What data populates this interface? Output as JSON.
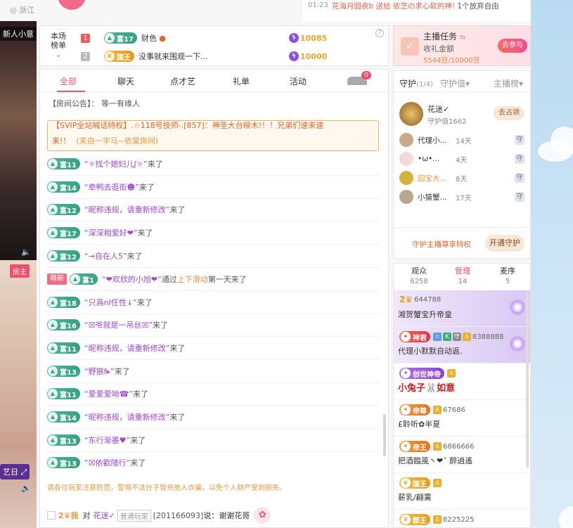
{
  "topbar": {
    "location": "浙江",
    "time": "01:23",
    "marquee_pre": "花海月圆夜b 送给 ",
    "marquee_mid": "依芝の求心软的神!",
    "marquee_post": "  1个放弃自由"
  },
  "leftstrip": {
    "tag_top": "新人小意",
    "tag_host": "房主",
    "tag_bottom": "艺日"
  },
  "rank": {
    "title": "本场榜单",
    "rows": [
      {
        "num": "1",
        "level": "富17",
        "name": "财色",
        "score": "10085",
        "num_color": "#f05a5a"
      },
      {
        "num": "2",
        "level": "国王",
        "name": "没事就来围观一下...",
        "score": "10000",
        "num_color": "#bbbbbb"
      }
    ]
  },
  "task": {
    "title": "主播任务",
    "subtitle": "收礼金额",
    "progress": "5544豆/10000豆",
    "button": "去参与"
  },
  "chat": {
    "tabs": [
      "全部",
      "聊天",
      "点才艺",
      "礼单",
      "活动"
    ],
    "car_count": "0",
    "notice": "【房间公告】：  等一有缘人",
    "svip_line1": "【SVIP全站喊话特权】.☆118号技师-.[857]：神圣大台映木!！！兄弟们速来速",
    "svip_line2": "来!！",
    "svip_from": "(来自一字马~依棠房间)",
    "messages": [
      {
        "level": "富11",
        "name": "“☼找个媳妇儿ʃ☼”",
        "text": "来了"
      },
      {
        "level": "富14",
        "name": "“牵鸭去逛街☻”",
        "text": "来了"
      },
      {
        "level": "富12",
        "name": "“昵称违规，请重新修改”",
        "text": "来了"
      },
      {
        "level": "富17",
        "name": "“深深相爱好❤”",
        "text": "来了"
      },
      {
        "level": "富12",
        "name": "“→自在人5”",
        "text": "来了"
      },
      {
        "new": "萌新",
        "level": "富1",
        "name": "“❤欢欣的小旭❤”",
        "text": "通过",
        "hl": "上下滑动",
        "text2": "第一天来了"
      },
      {
        "level": "富18",
        "name": "“只爲nI任性↓”",
        "text": "来了"
      },
      {
        "level": "富16",
        "name": "“☒爷就是一吊丝☒”",
        "text": "来了"
      },
      {
        "level": "富11",
        "name": "“昵称违规，请重新修改”",
        "text": "来了"
      },
      {
        "level": "富13",
        "name": "“野狼f▸”",
        "text": "来了"
      },
      {
        "level": "富11",
        "name": "“爱爱爱呦☎”",
        "text": "来了"
      },
      {
        "level": "富14",
        "name": "“昵称违规，请重新修改”",
        "text": "来了"
      },
      {
        "level": "富13",
        "name": "“东行渐墨♥”",
        "text": "来了"
      },
      {
        "level": "富13",
        "name": "“☒依歡隨行”",
        "text": "来了"
      }
    ],
    "warning": "请各位玩家注意防范，警惕不法分子冒充他人诈骗，以免个人财产受到损失。",
    "bottom_me": "2♛我",
    "bottom_to": "对",
    "bottom_target": "花迷✓",
    "bottom_tag": "普通玩家",
    "bottom_id": "[201166093]",
    "bottom_say": "说：",
    "bottom_text": "谢谢花哥"
  },
  "guard": {
    "tab1": "守护",
    "tab1_count": "(1/4)",
    "tab2": "守护值▾",
    "tab3": "主播榜▾",
    "top_name": "花迷✓",
    "top_value": "守护值1662",
    "claim": "去占领",
    "list": [
      {
        "name": "代理小...",
        "days": "14天",
        "color": "#c9a98a"
      },
      {
        "name": "•ω•...",
        "days": "4天",
        "color": "#f3d9d9"
      },
      {
        "name": "园宝大...",
        "days": "8天",
        "color": "#d4b23c"
      },
      {
        "name": "小猿蟹...",
        "days": "17天",
        "color": "#b8a890"
      }
    ],
    "footer_text": "守护主播尊享特权",
    "open_button": "开通守护"
  },
  "audience": {
    "tabs": [
      {
        "label": "观众",
        "count": "6258"
      },
      {
        "label": "管理",
        "count": "14"
      },
      {
        "label": "麦序",
        "count": "5"
      }
    ],
    "users": [
      {
        "id": "644788",
        "name": "湘贺蟹宝升帝皇",
        "badge": "",
        "vip": true
      },
      {
        "id": "8388888",
        "name": "代理小默默自动返.",
        "badge": "神君",
        "vip": true
      },
      {
        "id": "",
        "name": "小兔子🐰如意",
        "badge": "创世神帝",
        "vip": false,
        "big": true
      },
      {
        "id": "67686",
        "name": "£聆听✿半夏",
        "badge": "帝尊",
        "vip": false
      },
      {
        "id": "6866666",
        "name": "把酒臨風丶❤ˇ 醉逍遙",
        "badge": "帝王",
        "vip": false
      },
      {
        "id": "",
        "name": "薪乳/翩霙",
        "badge": "国王",
        "vip": false
      },
      {
        "id": "8225225",
        "name": "",
        "badge": "郡王",
        "vip": false
      }
    ]
  }
}
